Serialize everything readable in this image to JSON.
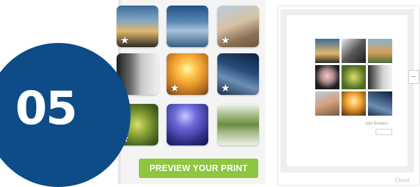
{
  "step": {
    "number": "05",
    "badge_color": "#0d4c87"
  },
  "editor": {
    "preview_button_label": "PREVIEW YOUR PRINT",
    "button_color": "#8dc63f",
    "photos": [
      {
        "name": "photo-sunset-tree",
        "starred": true
      },
      {
        "name": "photo-foggy-lake",
        "starred": false
      },
      {
        "name": "photo-selfie-stick",
        "starred": true
      },
      {
        "name": "photo-bw-bridge",
        "starred": false
      },
      {
        "name": "photo-golden-sunset",
        "starred": true
      },
      {
        "name": "photo-milky-way",
        "starred": true
      },
      {
        "name": "photo-forest-canopy",
        "starred": true
      },
      {
        "name": "photo-lightning",
        "starred": false
      },
      {
        "name": "photo-tree-reflection",
        "starred": false
      }
    ],
    "star_glyph": "★"
  },
  "print_preview": {
    "add_borders_label": "Add Borders",
    "footer_label": "Cover",
    "photo_count": 9
  }
}
